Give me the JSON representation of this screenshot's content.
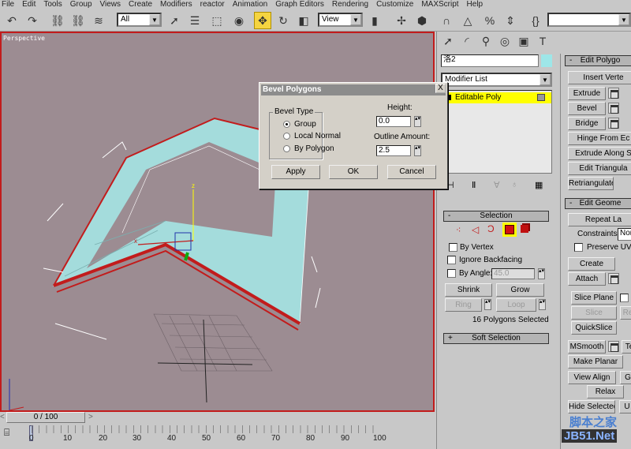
{
  "menu": [
    "File",
    "Edit",
    "Tools",
    "Group",
    "Views",
    "Create",
    "Modifiers",
    "reactor",
    "Animation",
    "Graph Editors",
    "Rendering",
    "Customize",
    "MAXScript",
    "Help"
  ],
  "toolbar": {
    "selection_filter": "All",
    "reference_coord": "View",
    "named_selection": ""
  },
  "viewport": {
    "label": "Perspective",
    "axis_labels": {
      "x": "x",
      "y": "y",
      "z": "z"
    }
  },
  "timeslider": {
    "value": "0 / 100",
    "prev": "<",
    "next": ">"
  },
  "trackbar": {
    "ticks": [
      "0",
      "10",
      "20",
      "30",
      "40",
      "50",
      "60",
      "70",
      "80",
      "90",
      "100"
    ]
  },
  "dialog": {
    "title": "Bevel Polygons",
    "close": "X",
    "group_label": "Bevel Type",
    "options": [
      "Group",
      "Local Normal",
      "By Polygon"
    ],
    "selected": "Group",
    "height_label": "Height:",
    "height_value": "0.0",
    "outline_label": "Outline Amount:",
    "outline_value": "2.5",
    "apply": "Apply",
    "ok": "OK",
    "cancel": "Cancel"
  },
  "command_panel": {
    "object_name": "洛2",
    "object_color": "#9ee6e8",
    "modifier_list": "Modifier List",
    "stack": [
      {
        "label": "Editable Poly",
        "highlight": "#ffff00"
      }
    ],
    "selection": {
      "title": "Selection",
      "toggle": "-",
      "by_vertex": "By Vertex",
      "ignore_backfacing": "Ignore Backfacing",
      "by_angle": "By Angle:",
      "angle_value": "45.0",
      "shrink": "Shrink",
      "grow": "Grow",
      "ring": "Ring",
      "loop": "Loop",
      "status": "16 Polygons Selected"
    },
    "soft_selection": {
      "title": "Soft Selection",
      "toggle": "+"
    },
    "edit_polygons": {
      "title": "Edit Polygo",
      "toggle": "-",
      "buttons": [
        "Insert Verte",
        "Extrude",
        "Bevel",
        "Bridge",
        "Hinge From Ec",
        "Extrude Along S",
        "Edit Triangula",
        "Retriangulate"
      ]
    },
    "edit_geometry": {
      "title": "Edit Geome",
      "toggle": "-",
      "repeat": "Repeat La",
      "constraints_label": "Constraints:",
      "constraints_value": "Nor",
      "preserve_uvs": "Preserve UVs",
      "create": "Create",
      "attach": "Attach",
      "slice_plane": "Slice Plane",
      "slice": "Slice",
      "reset": "Re",
      "quickslice": "QuickSlice",
      "msmooth": "MSmooth",
      "tessellate": "Te",
      "make_planar": "Make Planar",
      "view_align": "View Align",
      "grid_align": "G",
      "relax": "Relax",
      "hide_selected": "Hide Selected",
      "unhide": "U"
    }
  },
  "watermark": {
    "line1": "脚本之家",
    "line2": "JB51.Net"
  }
}
